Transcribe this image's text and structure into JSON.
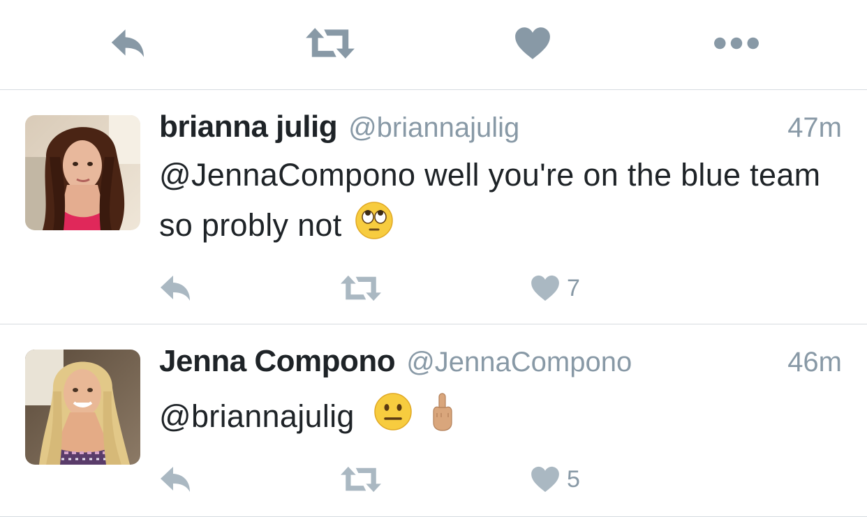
{
  "focused_tweet_actions": {
    "icons": [
      "reply-icon",
      "retweet-icon",
      "like-icon",
      "more-icon"
    ]
  },
  "tweets": [
    {
      "name": "brianna julig",
      "handle": "@briannajulig",
      "time": "47m",
      "text": "@JennaCompono well you're on the blue team so probly not",
      "emojis": [
        "face-with-rolling-eyes-emoji"
      ],
      "reply_count": "",
      "retweet_count": "",
      "like_count": "7"
    },
    {
      "name": "Jenna Compono",
      "handle": "@JennaCompono",
      "time": "46m",
      "text": "@briannajulig",
      "emojis": [
        "neutral-face-emoji",
        "middle-finger-emoji"
      ],
      "reply_count": "",
      "retweet_count": "",
      "like_count": "5"
    }
  ],
  "colors": {
    "icon_gray": "#8899a6",
    "icon_light_gray": "#aab8c2",
    "name_text": "#1e2327",
    "divider": "#d6dbe0"
  }
}
